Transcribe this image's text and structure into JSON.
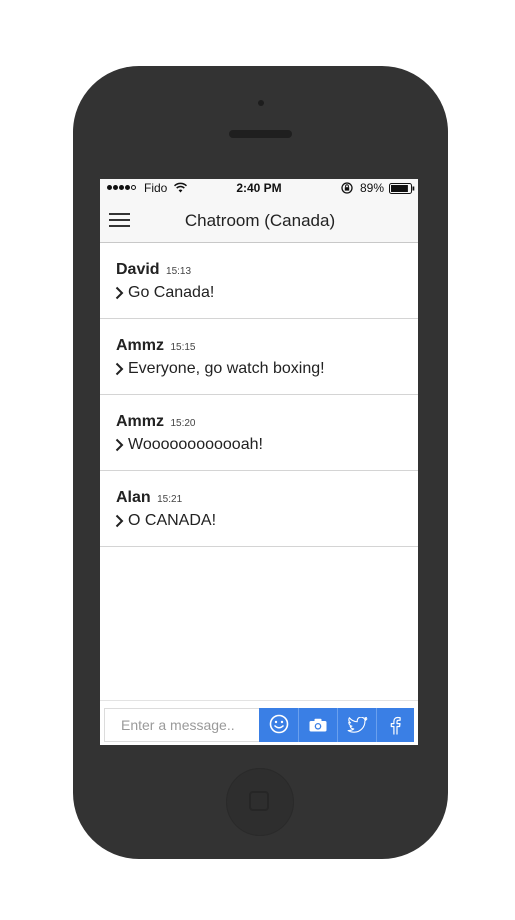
{
  "status_bar": {
    "carrier": "Fido",
    "time": "2:40 PM",
    "battery": "89%",
    "battery_level": 0.89
  },
  "nav": {
    "title": "Chatroom (Canada)"
  },
  "messages": [
    {
      "name": "David",
      "time": "15:13",
      "text": "Go Canada!"
    },
    {
      "name": "Ammz",
      "time": "15:15",
      "text": "Everyone, go watch boxing!"
    },
    {
      "name": "Ammz",
      "time": "15:20",
      "text": "Woooooooooooah!"
    },
    {
      "name": "Alan",
      "time": "15:21",
      "text": "O CANADA!"
    }
  ],
  "composer": {
    "placeholder": "Enter a message..",
    "value": "",
    "actions": [
      "smiley-icon",
      "camera-icon",
      "twitter-icon",
      "facebook-icon"
    ],
    "accent": "#3a7fe5"
  },
  "colors": {
    "device": "#333333",
    "bar_background": "#f7f7f7"
  }
}
